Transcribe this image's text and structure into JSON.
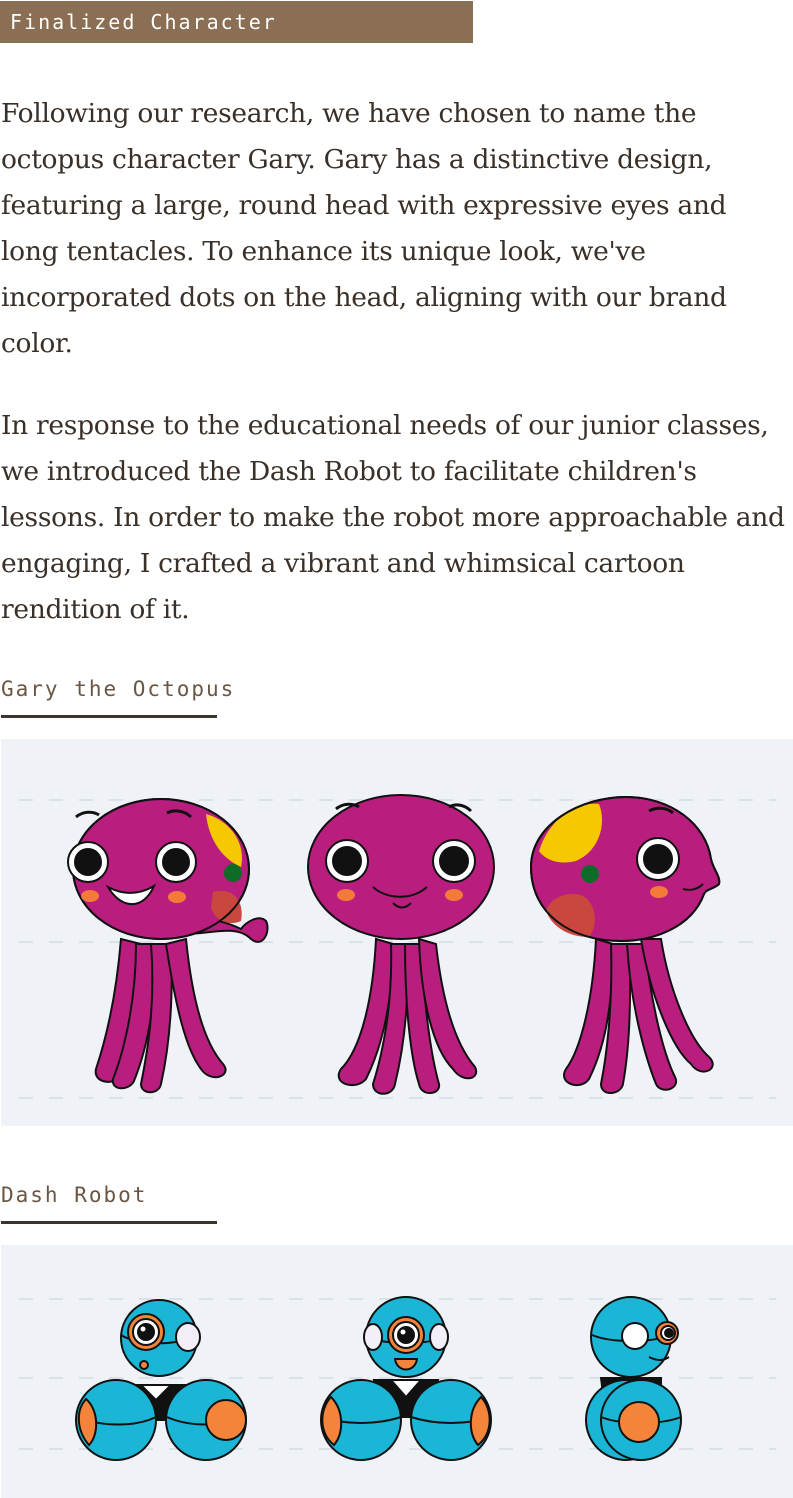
{
  "section_tag": "Finalized Character",
  "paragraphs": [
    "Following our research, we have chosen to name the octopus character Gary. Gary has a distinctive design, featuring a large, round head with expressive eyes and long tentacles. To enhance its unique look, we've incorporated dots on the head, aligning with our brand color.",
    "In response to the educational needs of our junior classes, we introduced the Dash Robot to facilitate children's lessons. In order to make the robot more approachable and engaging, I crafted a vibrant and whimsical cartoon rendition of it."
  ],
  "gary": {
    "heading": "Gary the Octopus",
    "views": [
      "three-quarter",
      "front",
      "side"
    ]
  },
  "dash": {
    "heading": "Dash Robot",
    "views": [
      "three-quarter",
      "front",
      "side"
    ]
  },
  "colors": {
    "tag_bg": "#8a6f55",
    "octopus_body": "#b91e7f",
    "octopus_yellow": "#f6c800",
    "octopus_green": "#0e6c28",
    "octopus_red": "#c9473e",
    "cheek": "#f47a3a",
    "robot_blue": "#1bb6d6",
    "robot_orange": "#f4843a",
    "panel_bg": "#eff3f8"
  }
}
